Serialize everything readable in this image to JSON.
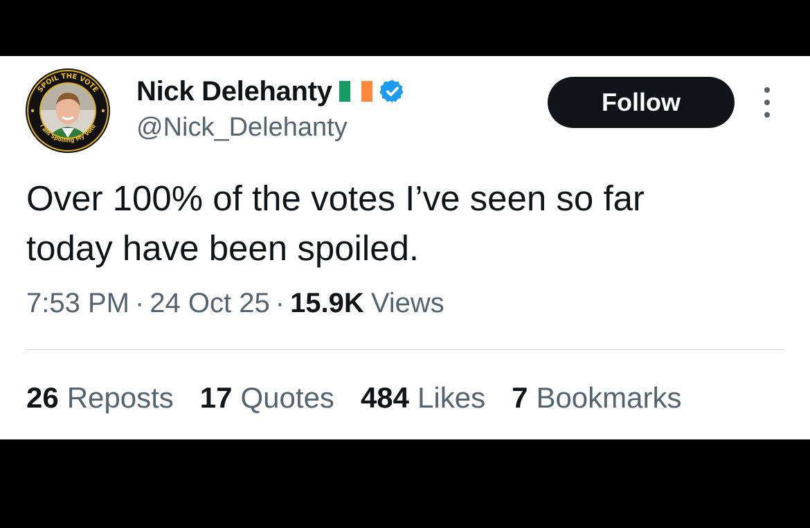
{
  "user": {
    "display_name": "Nick Delehanty",
    "handle": "@Nick_Delehanty",
    "flag_colors": [
      "#169b62",
      "#ffffff",
      "#ff883e"
    ],
    "verified_color": "#1d9bf0",
    "avatar": {
      "ring_text_top": "SPOIL THE VOTE",
      "ring_text_bottom": "I am Spoiling My Vote",
      "ring_color": "#f0c020"
    }
  },
  "follow_button": {
    "label": "Follow"
  },
  "tweet": {
    "text_line1": "Over 100% of the votes I’ve seen so far",
    "text_line2": "today have been spoiled."
  },
  "meta": {
    "time": "7:53 PM",
    "separator": "·",
    "date": "24 Oct 25",
    "views_count": "15.9K",
    "views_label": "Views"
  },
  "stats": [
    {
      "count": "26",
      "label": "Reposts"
    },
    {
      "count": "17",
      "label": "Quotes"
    },
    {
      "count": "484",
      "label": "Likes"
    },
    {
      "count": "7",
      "label": "Bookmarks"
    }
  ]
}
